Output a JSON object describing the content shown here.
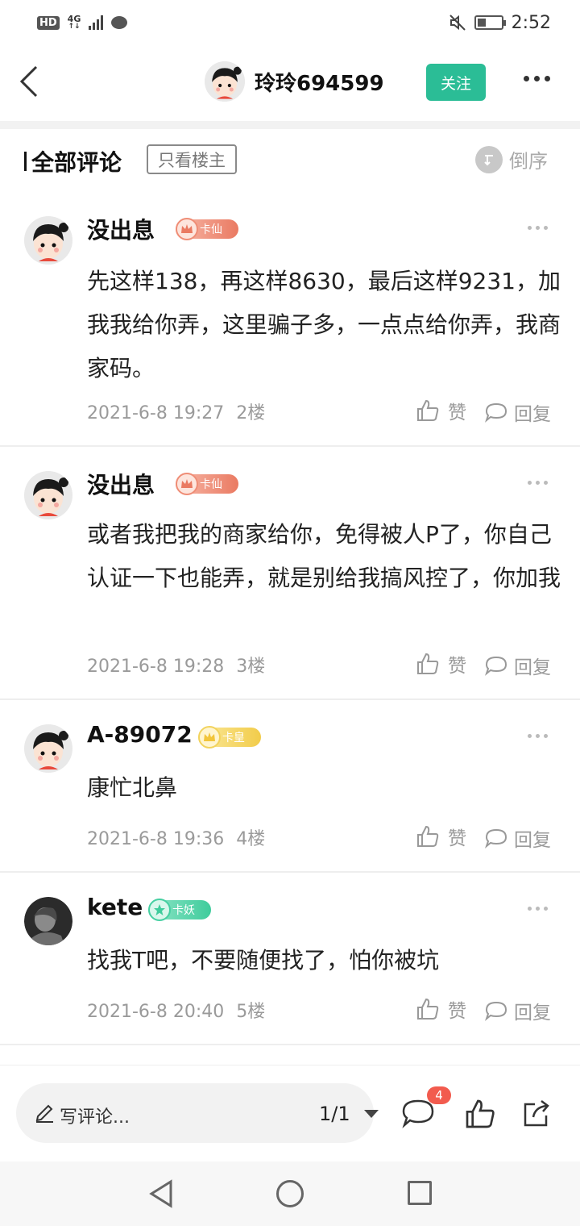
{
  "status_bar": {
    "hd": "HD",
    "network": "4G",
    "network_sub": "↑↓",
    "time": "2:52"
  },
  "header": {
    "username": "玲玲694599",
    "follow_label": "关注"
  },
  "filter": {
    "section_title": "全部评论",
    "only_author_label": "只看楼主",
    "sort_label": "倒序"
  },
  "comments": [
    {
      "name": "没出息",
      "badge": "卡仙",
      "text": "先这样138，再这样8630，最后这样9231，加我我给你弄，这里骗子多，一点点给你弄，我商家码。",
      "time": "2021-6-8 19:27",
      "floor": "2楼",
      "like_label": "赞",
      "reply_label": "回复"
    },
    {
      "name": "没出息",
      "badge": "卡仙",
      "text": "或者我把我的商家给你，免得被人P了，你自己认证一下也能弄，就是别给我搞风控了，你加我",
      "time": "2021-6-8 19:28",
      "floor": "3楼",
      "like_label": "赞",
      "reply_label": "回复"
    },
    {
      "name": "A-89072",
      "badge": "卡皇",
      "text": "康忙北鼻",
      "time": "2021-6-8 19:36",
      "floor": "4楼",
      "like_label": "赞",
      "reply_label": "回复"
    },
    {
      "name": "kete",
      "badge": "卡妖",
      "text": "找我T吧，不要随便找了，怕你被坑",
      "time": "2021-6-8 20:40",
      "floor": "5楼",
      "like_label": "赞",
      "reply_label": "回复"
    }
  ],
  "bottom_bar": {
    "write_label": "写评论...",
    "page_indicator": "1/1",
    "comment_count": "4"
  },
  "colors": {
    "accent": "#2bbd96",
    "badge_count": "#f25b4e"
  },
  "icons": {
    "back": "chevron-left-icon",
    "more": "more-dots-icon",
    "sort": "sort-icon",
    "like": "thumbs-up-icon",
    "reply": "speech-bubble-icon",
    "write": "pencil-icon",
    "share": "share-icon"
  }
}
